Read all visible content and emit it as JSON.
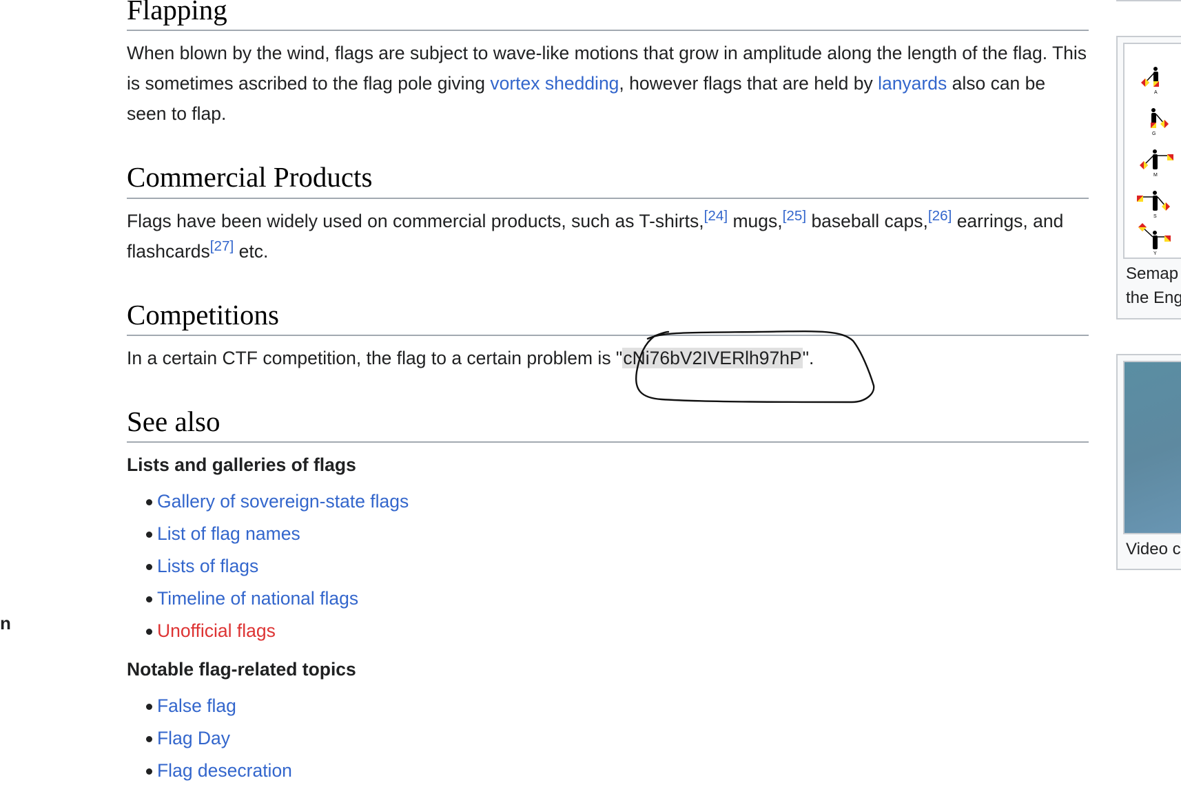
{
  "article": {
    "sections": {
      "flapping": {
        "heading": "Flapping",
        "text_before_link1": "When blown by the wind, flags are subject to wave-like motions that grow in amplitude along the length of the flag. This is sometimes ascribed to the flag pole giving ",
        "link1": "vortex shedding",
        "text_between": ", however flags that are held by ",
        "link2": "lanyards",
        "text_after": " also can be seen to flap."
      },
      "commercial": {
        "heading": "Commercial Products",
        "t1": "Flags have been widely used on commercial products, such as T-shirts,",
        "ref1": "[24]",
        "t2": " mugs,",
        "ref2": "[25]",
        "t3": " baseball caps,",
        "ref3": "[26]",
        "t4": " earrings, and flashcards",
        "ref4": "[27]",
        "t5": " etc."
      },
      "competitions": {
        "heading": "Competitions",
        "t1": "In a certain CTF competition, the flag to a certain problem is \"",
        "flag": "cNi76bV2IVERlh97hP",
        "t2": "\"."
      },
      "see_also": {
        "heading": "See also",
        "group1_title": "Lists and galleries of flags",
        "group1_items": [
          {
            "label": "Gallery of sovereign-state flags",
            "missing": false
          },
          {
            "label": "List of flag names",
            "missing": false
          },
          {
            "label": "Lists of flags",
            "missing": false
          },
          {
            "label": "Timeline of national flags",
            "missing": false
          },
          {
            "label": "Unofficial flags",
            "missing": true
          }
        ],
        "group2_title": "Notable flag-related topics",
        "group2_items": [
          {
            "label": "False flag",
            "missing": false
          },
          {
            "label": "Flag Day",
            "missing": false
          },
          {
            "label": "Flag desecration",
            "missing": false
          }
        ]
      }
    }
  },
  "left_fragment": "n",
  "sidebar_thumbs": {
    "semaphore": {
      "caption_line1": "Semap",
      "caption_line2": "the Eng",
      "letters": [
        "A",
        "G",
        "M",
        "S",
        "Y"
      ]
    },
    "video": {
      "caption": "Video c"
    }
  },
  "colors": {
    "link": "#3366cc",
    "redlink": "#dd3333",
    "highlight": "#e0e0e0",
    "heading_rule": "#a2a9b1"
  }
}
